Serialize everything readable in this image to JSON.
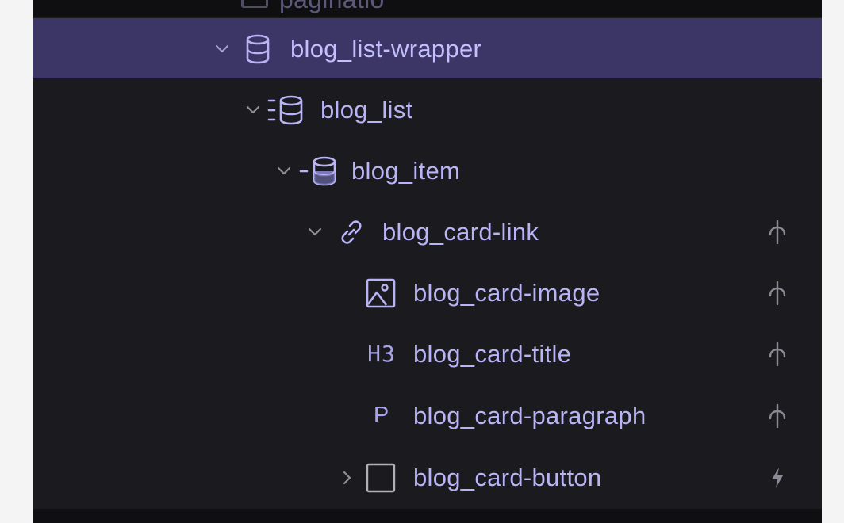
{
  "panel": {
    "partial_row": {
      "label": "paginatio"
    },
    "rows": [
      {
        "label": "blog_list-wrapper",
        "icon": "database-icon",
        "expanded": true,
        "selected": true,
        "action": null
      },
      {
        "label": "blog_list",
        "icon": "collection-list-icon",
        "expanded": true,
        "selected": false,
        "action": null
      },
      {
        "label": "blog_item",
        "icon": "collection-item-icon",
        "expanded": true,
        "selected": false,
        "action": null
      },
      {
        "label": "blog_card-link",
        "icon": "link-icon",
        "expanded": true,
        "selected": false,
        "action": "style-anchor-icon"
      },
      {
        "label": "blog_card-image",
        "icon": "image-icon",
        "expanded": null,
        "selected": false,
        "action": "style-anchor-icon"
      },
      {
        "label": "blog_card-title",
        "icon": "heading-icon",
        "icon_text": "H3",
        "expanded": null,
        "selected": false,
        "action": "style-anchor-icon"
      },
      {
        "label": "blog_card-paragraph",
        "icon": "paragraph-icon",
        "icon_text": "P",
        "expanded": null,
        "selected": false,
        "action": "style-anchor-icon"
      },
      {
        "label": "blog_card-button",
        "icon": "block-icon",
        "expanded": false,
        "selected": false,
        "action": "interaction-bolt-icon"
      }
    ]
  },
  "colors": {
    "panel_bg": "#1b1b1f",
    "selected_bg": "#3c3666",
    "label": "#b9b4f6",
    "icon": "#a9a4ea",
    "arrow": "#8f8f9a",
    "action_icon": "#8a8a94"
  }
}
